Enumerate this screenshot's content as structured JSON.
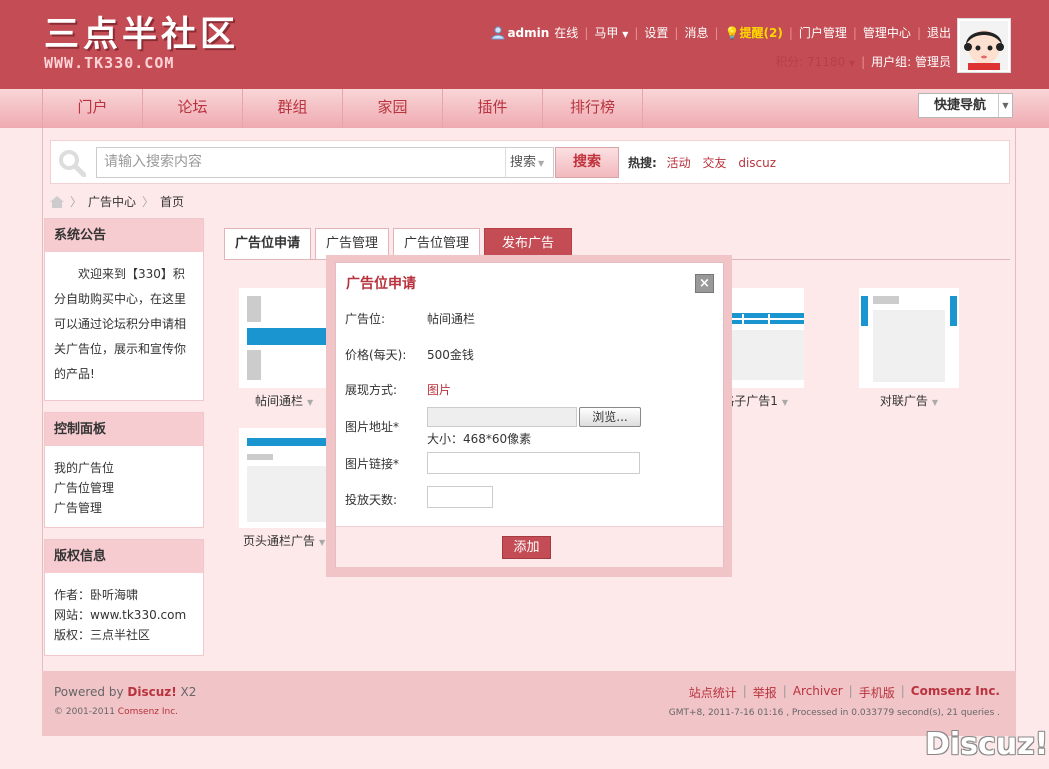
{
  "header": {
    "logo_text": "三点半社区",
    "logo_url_text": "WWW.TK330.COM",
    "username": "admin",
    "online": "在线",
    "user_menu": "马甲",
    "settings": "设置",
    "messages": "消息",
    "alerts": "提醒(2)",
    "portal_admin": "门户管理",
    "admin_center": "管理中心",
    "logout": "退出",
    "credits": "积分: 71180",
    "usergroup": "用户组: 管理员"
  },
  "nav": {
    "items": [
      "门户",
      "论坛",
      "群组",
      "家园",
      "插件",
      "排行榜"
    ],
    "quick_nav": "快捷导航"
  },
  "search": {
    "placeholder": "请输入搜索内容",
    "scope": "搜索",
    "button": "搜索",
    "hot_label": "热搜:",
    "hot": [
      "活动",
      "交友",
      "discuz"
    ]
  },
  "breadcrumb": [
    "广告中心",
    "首页"
  ],
  "sidebar": {
    "notice_title": "系统公告",
    "notice_text": "欢迎来到【330】积分自助购买中心，在这里可以通过论坛积分申请相关广告位，展示和宣传你的产品!",
    "panel_title": "控制面板",
    "panel_items": [
      "我的广告位",
      "广告位管理",
      "广告管理"
    ],
    "copyright_title": "版权信息",
    "copyright_items": [
      "作者：卧听海啸",
      "网站：www.tk330.com",
      "版权：三点半社区"
    ]
  },
  "tabs": [
    "广告位申请",
    "广告管理",
    "广告位管理",
    "发布广告"
  ],
  "positions": [
    "帖间通栏",
    "格子广告1",
    "对联广告",
    "页头通栏广告"
  ],
  "dialog": {
    "title": "广告位申请",
    "close": "×",
    "pos_label": "广告位:",
    "pos_value": "帖间通栏",
    "price_label": "价格(每天):",
    "price_value": "500金钱",
    "display_label": "展现方式:",
    "display_value": "图片",
    "img_url_label": "图片地址*",
    "browse": "浏览...",
    "size_hint": "大小：468*60像素",
    "img_link_label": "图片链接*",
    "days_label": "投放天数:",
    "add_button": "添加"
  },
  "footer": {
    "powered": "Powered by ",
    "discuz": "Discuz!",
    "version": " X2",
    "copyright": "© 2001-2011 ",
    "comsenz": "Comsenz Inc.",
    "links": [
      "站点统计",
      "举报",
      "Archiver",
      "手机版"
    ],
    "brand": "Comsenz Inc.",
    "stats": "GMT+8, 2011-7-16 01:16 , Processed in 0.033779 second(s), 21 queries ."
  },
  "watermark": "Discuz!",
  "colors": {
    "primary": "#c44d55",
    "accent": "#b8333d",
    "background": "#fde9ea"
  }
}
